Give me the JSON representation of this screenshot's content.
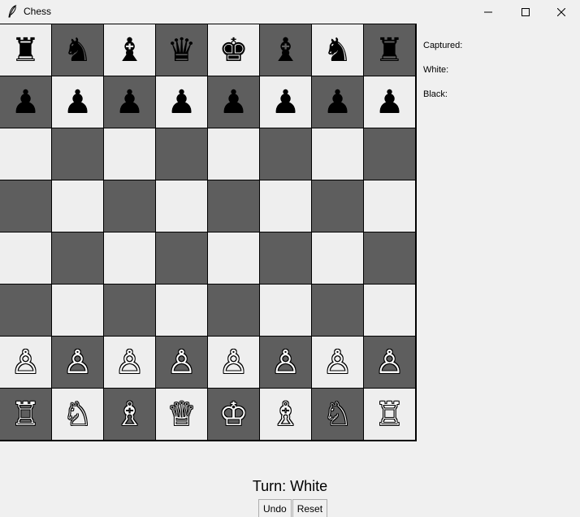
{
  "window": {
    "title": "Chess",
    "icon": "feather-icon"
  },
  "board": {
    "light_color": "#eeeeee",
    "dark_color": "#5e5e5e",
    "ranks": [
      [
        "♜",
        "♞",
        "♝",
        "♛",
        "♚",
        "♝",
        "♞",
        "♜"
      ],
      [
        "♟",
        "♟",
        "♟",
        "♟",
        "♟",
        "♟",
        "♟",
        "♟"
      ],
      [
        "",
        "",
        "",
        "",
        "",
        "",
        "",
        ""
      ],
      [
        "",
        "",
        "",
        "",
        "",
        "",
        "",
        ""
      ],
      [
        "",
        "",
        "",
        "",
        "",
        "",
        "",
        ""
      ],
      [
        "",
        "",
        "",
        "",
        "",
        "",
        "",
        ""
      ],
      [
        "♙",
        "♙",
        "♙",
        "♙",
        "♙",
        "♙",
        "♙",
        "♙"
      ],
      [
        "♖",
        "♘",
        "♗",
        "♕",
        "♔",
        "♗",
        "♘",
        "♖"
      ]
    ]
  },
  "side_panel": {
    "captured_label": "Captured:",
    "white_label": "White:",
    "black_label": "Black:"
  },
  "status": {
    "turn_text": "Turn: White"
  },
  "controls": {
    "undo_label": "Undo",
    "reset_label": "Reset"
  }
}
